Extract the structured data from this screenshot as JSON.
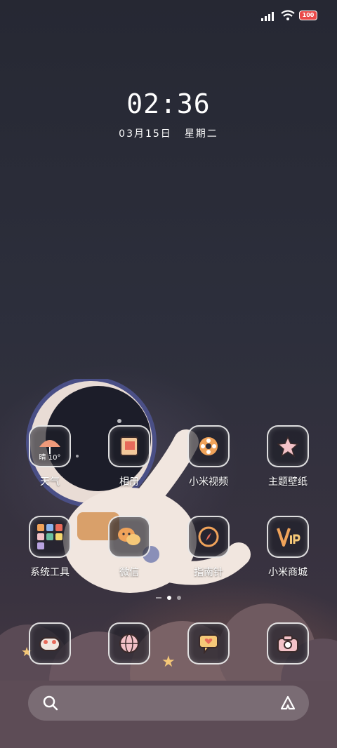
{
  "status_bar": {
    "battery": "100"
  },
  "lock": {
    "time": "02:36",
    "date": "03月15日",
    "weekday": "星期二"
  },
  "apps": [
    {
      "label": "天气",
      "icon": "weather-icon",
      "temp": "晴 10°"
    },
    {
      "label": "相册",
      "icon": "gallery-icon"
    },
    {
      "label": "小米视频",
      "icon": "video-icon"
    },
    {
      "label": "主题壁纸",
      "icon": "themes-icon"
    },
    {
      "label": "系统工具",
      "icon": "tools-folder-icon"
    },
    {
      "label": "微信",
      "icon": "wechat-icon"
    },
    {
      "label": "指南针",
      "icon": "compass-icon"
    },
    {
      "label": "小米商城",
      "icon": "mi-store-icon"
    }
  ],
  "dock": [
    {
      "icon": "phone-icon"
    },
    {
      "icon": "browser-icon"
    },
    {
      "icon": "messages-icon"
    },
    {
      "icon": "camera-icon"
    }
  ],
  "search": {
    "icon": "search-icon",
    "assistant_icon": "assistant-icon"
  },
  "colors": {
    "accent": "#f0a35a",
    "battery": "#e94a4a"
  }
}
